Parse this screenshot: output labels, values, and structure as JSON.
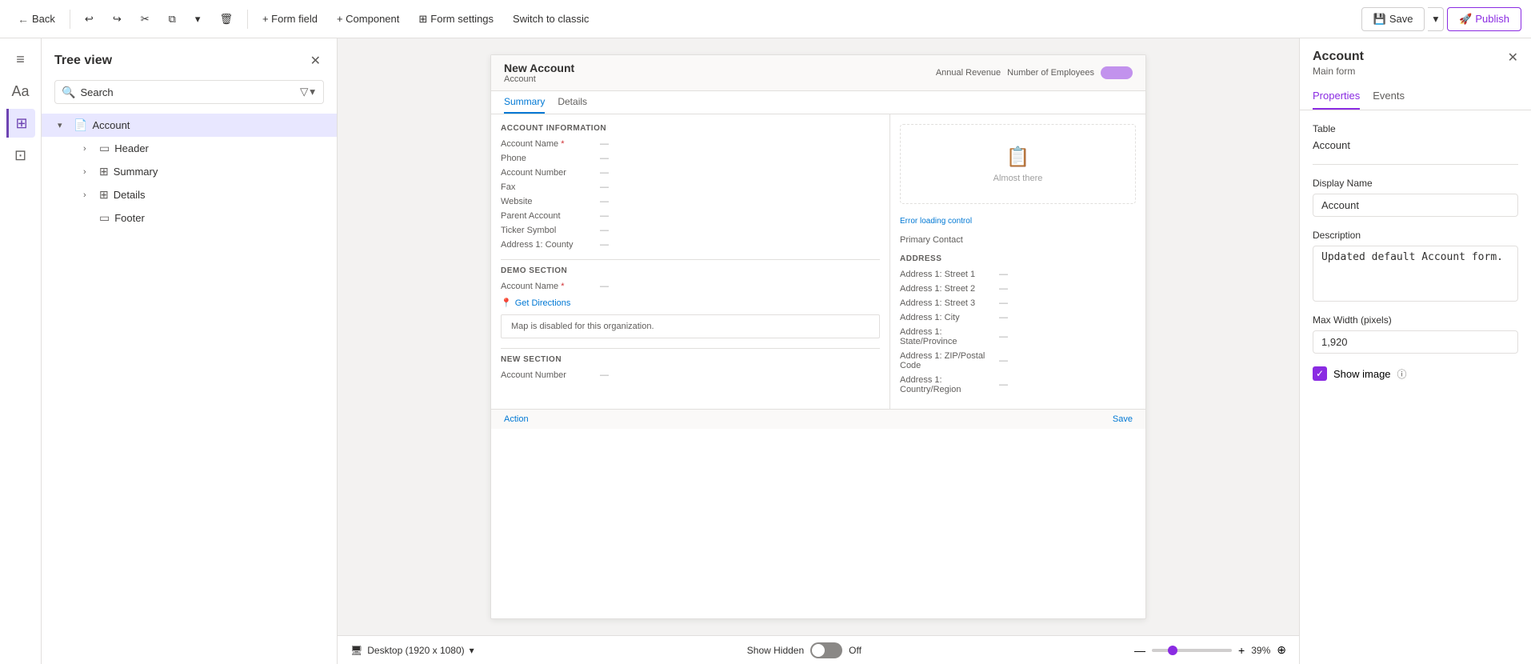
{
  "toolbar": {
    "back_label": "Back",
    "undo_icon": "↩",
    "redo_icon": "↪",
    "cut_icon": "✂",
    "copy_icon": "⧉",
    "paste_dropdown_icon": "▾",
    "delete_icon": "🗑",
    "add_field_label": "+ Form field",
    "add_component_label": "+ Component",
    "form_settings_label": "Form settings",
    "switch_classic_label": "Switch to classic",
    "save_label": "Save",
    "publish_label": "Publish"
  },
  "sidebar": {
    "title": "Tree view",
    "search_placeholder": "Search",
    "items": [
      {
        "id": "account",
        "label": "Account",
        "type": "form",
        "expanded": true,
        "selected": true
      },
      {
        "id": "header",
        "label": "Header",
        "type": "section"
      },
      {
        "id": "summary",
        "label": "Summary",
        "type": "tab"
      },
      {
        "id": "details",
        "label": "Details",
        "type": "tab"
      },
      {
        "id": "footer",
        "label": "Footer",
        "type": "section"
      }
    ]
  },
  "left_strip": {
    "icons": [
      "≡",
      "Aa",
      "⊞",
      "☰"
    ]
  },
  "form_preview": {
    "title": "New Account",
    "subtitle": "Account",
    "top_right": [
      "Annual Revenue",
      "Number of Employees"
    ],
    "tabs": [
      "Summary",
      "Details"
    ],
    "active_tab": "Summary",
    "sections": {
      "account_info": {
        "title": "ACCOUNT INFORMATION",
        "fields": [
          {
            "label": "Account Name",
            "required": true,
            "value": "—"
          },
          {
            "label": "Phone",
            "value": "—"
          },
          {
            "label": "Account Number",
            "value": "—"
          },
          {
            "label": "Fax",
            "value": "—"
          },
          {
            "label": "Website",
            "value": "—"
          },
          {
            "label": "Parent Account",
            "value": "—"
          },
          {
            "label": "Ticker Symbol",
            "value": "—"
          },
          {
            "label": "Address 1: County",
            "value": "—"
          }
        ]
      },
      "demo": {
        "title": "Demo Section",
        "fields": [
          {
            "label": "Account Name",
            "required": true,
            "value": "—"
          }
        ]
      },
      "new_section": {
        "title": "New Section",
        "fields": [
          {
            "label": "Account Number",
            "value": "—"
          }
        ]
      }
    },
    "timeline": {
      "icon": "📋",
      "text": "Almost there"
    },
    "error_link": "Error loading control",
    "primary_contact": "Primary Contact",
    "address": {
      "title": "ADDRESS",
      "fields": [
        {
          "label": "Address 1: Street 1",
          "value": "—"
        },
        {
          "label": "Address 1: Street 2",
          "value": "—"
        },
        {
          "label": "Address 1: Street 3",
          "value": "—"
        },
        {
          "label": "Address 1: City",
          "value": "—"
        },
        {
          "label": "Address 1: State/Province",
          "value": "—"
        },
        {
          "label": "Address 1: ZIP/Postal Code",
          "value": "—"
        },
        {
          "label": "Address 1: Country/Region",
          "value": "—"
        }
      ]
    },
    "map_text": "Map is disabled for this organization.",
    "get_directions": "Get Directions",
    "bottom_action": "Action",
    "bottom_save": "Save"
  },
  "bottom_bar": {
    "desktop_label": "Desktop (1920 x 1080)",
    "show_hidden_label": "Show Hidden",
    "toggle_label": "Off",
    "zoom_percent": "39%",
    "zoom_min": "—",
    "zoom_max": "+"
  },
  "right_panel": {
    "title": "Account",
    "subtitle": "Main form",
    "tabs": [
      "Properties",
      "Events"
    ],
    "active_tab": "Properties",
    "close_icon": "✕",
    "properties": {
      "table_label": "Table",
      "table_value": "Account",
      "display_name_label": "Display Name",
      "display_name_value": "Account",
      "description_label": "Description",
      "description_value": "Updated default Account form.",
      "max_width_label": "Max Width (pixels)",
      "max_width_value": "1,920",
      "show_image_label": "Show image",
      "show_image_checked": true
    }
  }
}
